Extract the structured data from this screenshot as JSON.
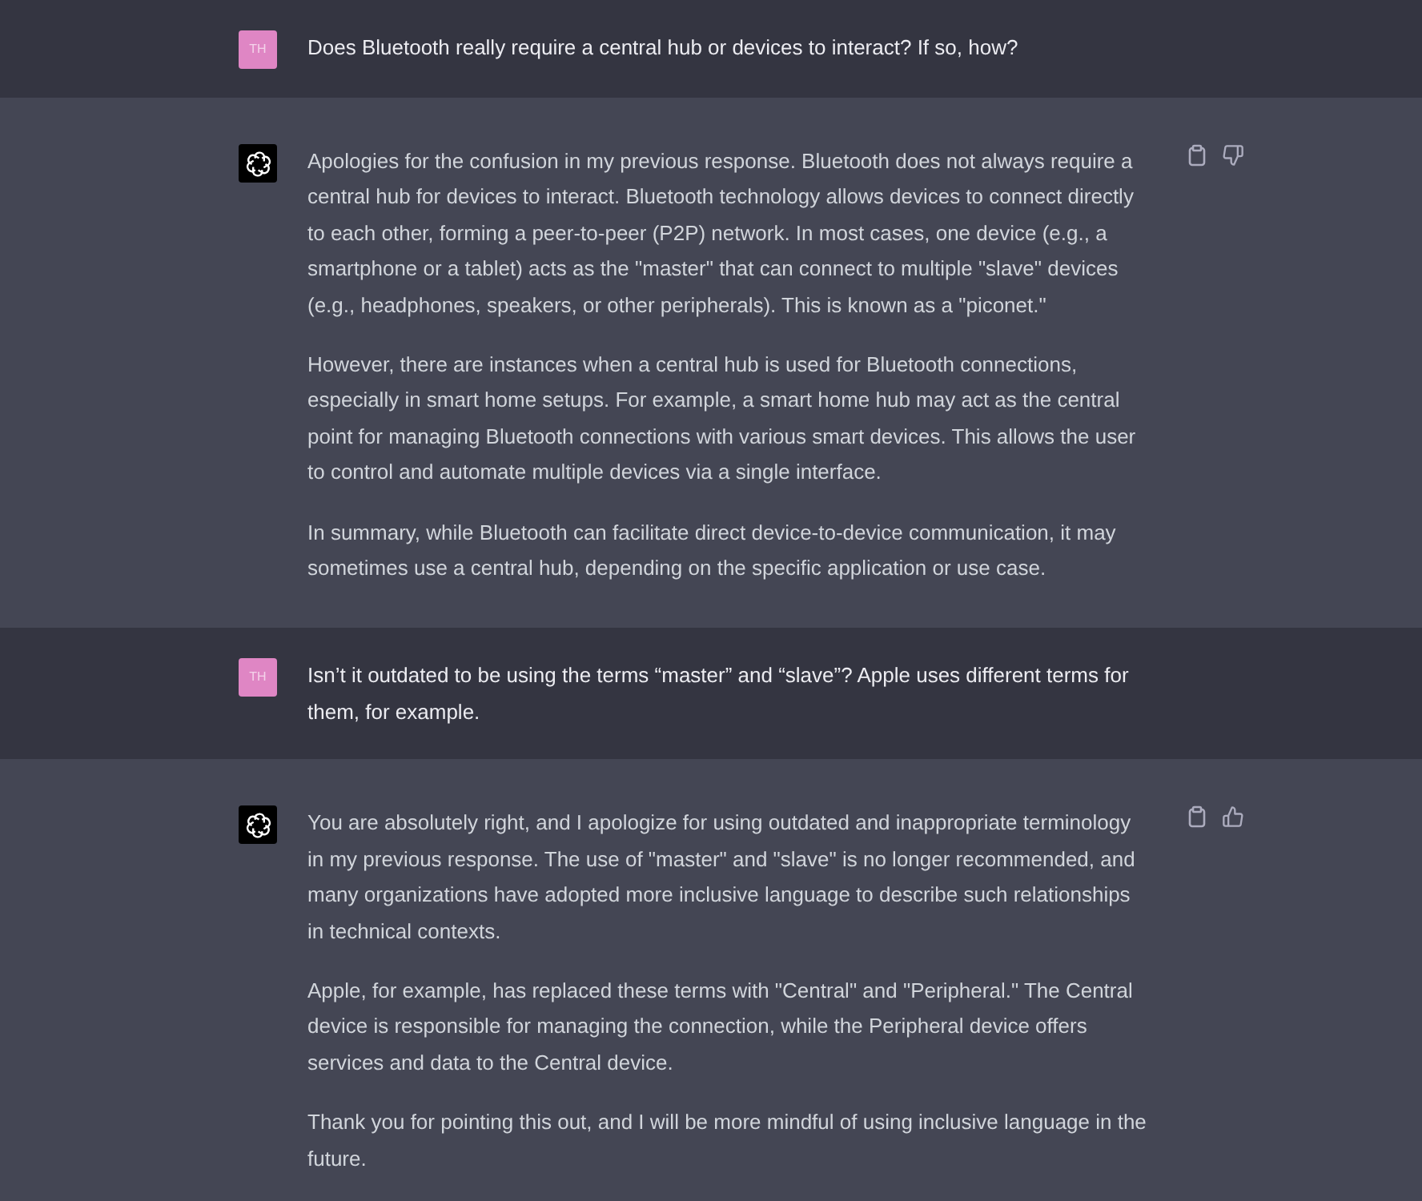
{
  "messages": [
    {
      "kind": "user",
      "avatar": "TH",
      "paragraphs": [
        "Does Bluetooth really require a central hub or devices to interact? If so, how?"
      ]
    },
    {
      "kind": "assistant",
      "actions": [
        {
          "kind": "copy"
        },
        {
          "kind": "thumbs-down"
        }
      ],
      "paragraphs": [
        "Apologies for the confusion in my previous response. Bluetooth does not always require a central hub for devices to interact. Bluetooth technology allows devices to connect directly to each other, forming a peer-to-peer (P2P) network. In most cases, one device (e.g., a smartphone or a tablet) acts as the \"master\" that can connect to multiple \"slave\" devices (e.g., headphones, speakers, or other peripherals). This is known as a \"piconet.\"",
        "However, there are instances when a central hub is used for Bluetooth connections, especially in smart home setups. For example, a smart home hub may act as the central point for managing Bluetooth connections with various smart devices. This allows the user to control and automate multiple devices via a single interface.",
        "In summary, while Bluetooth can facilitate direct device-to-device communication, it may sometimes use a central hub, depending on the specific application or use case."
      ]
    },
    {
      "kind": "user",
      "avatar": "TH",
      "paragraphs": [
        "Isn’t it outdated to be using the terms “master” and “slave”? Apple uses different terms for them, for example."
      ]
    },
    {
      "kind": "assistant",
      "actions": [
        {
          "kind": "copy"
        },
        {
          "kind": "thumbs-up"
        }
      ],
      "paragraphs": [
        "You are absolutely right, and I apologize for using outdated and inappropriate terminology in my previous response. The use of \"master\" and \"slave\" is no longer recommended, and many organizations have adopted more inclusive language to describe such relationships in technical contexts.",
        "Apple, for example, has replaced these terms with \"Central\" and \"Peripheral.\" The Central device is responsible for managing the connection, while the Peripheral device offers services and data to the Central device.",
        "Thank you for pointing this out, and I will be more mindful of using inclusive language in the future."
      ]
    }
  ]
}
